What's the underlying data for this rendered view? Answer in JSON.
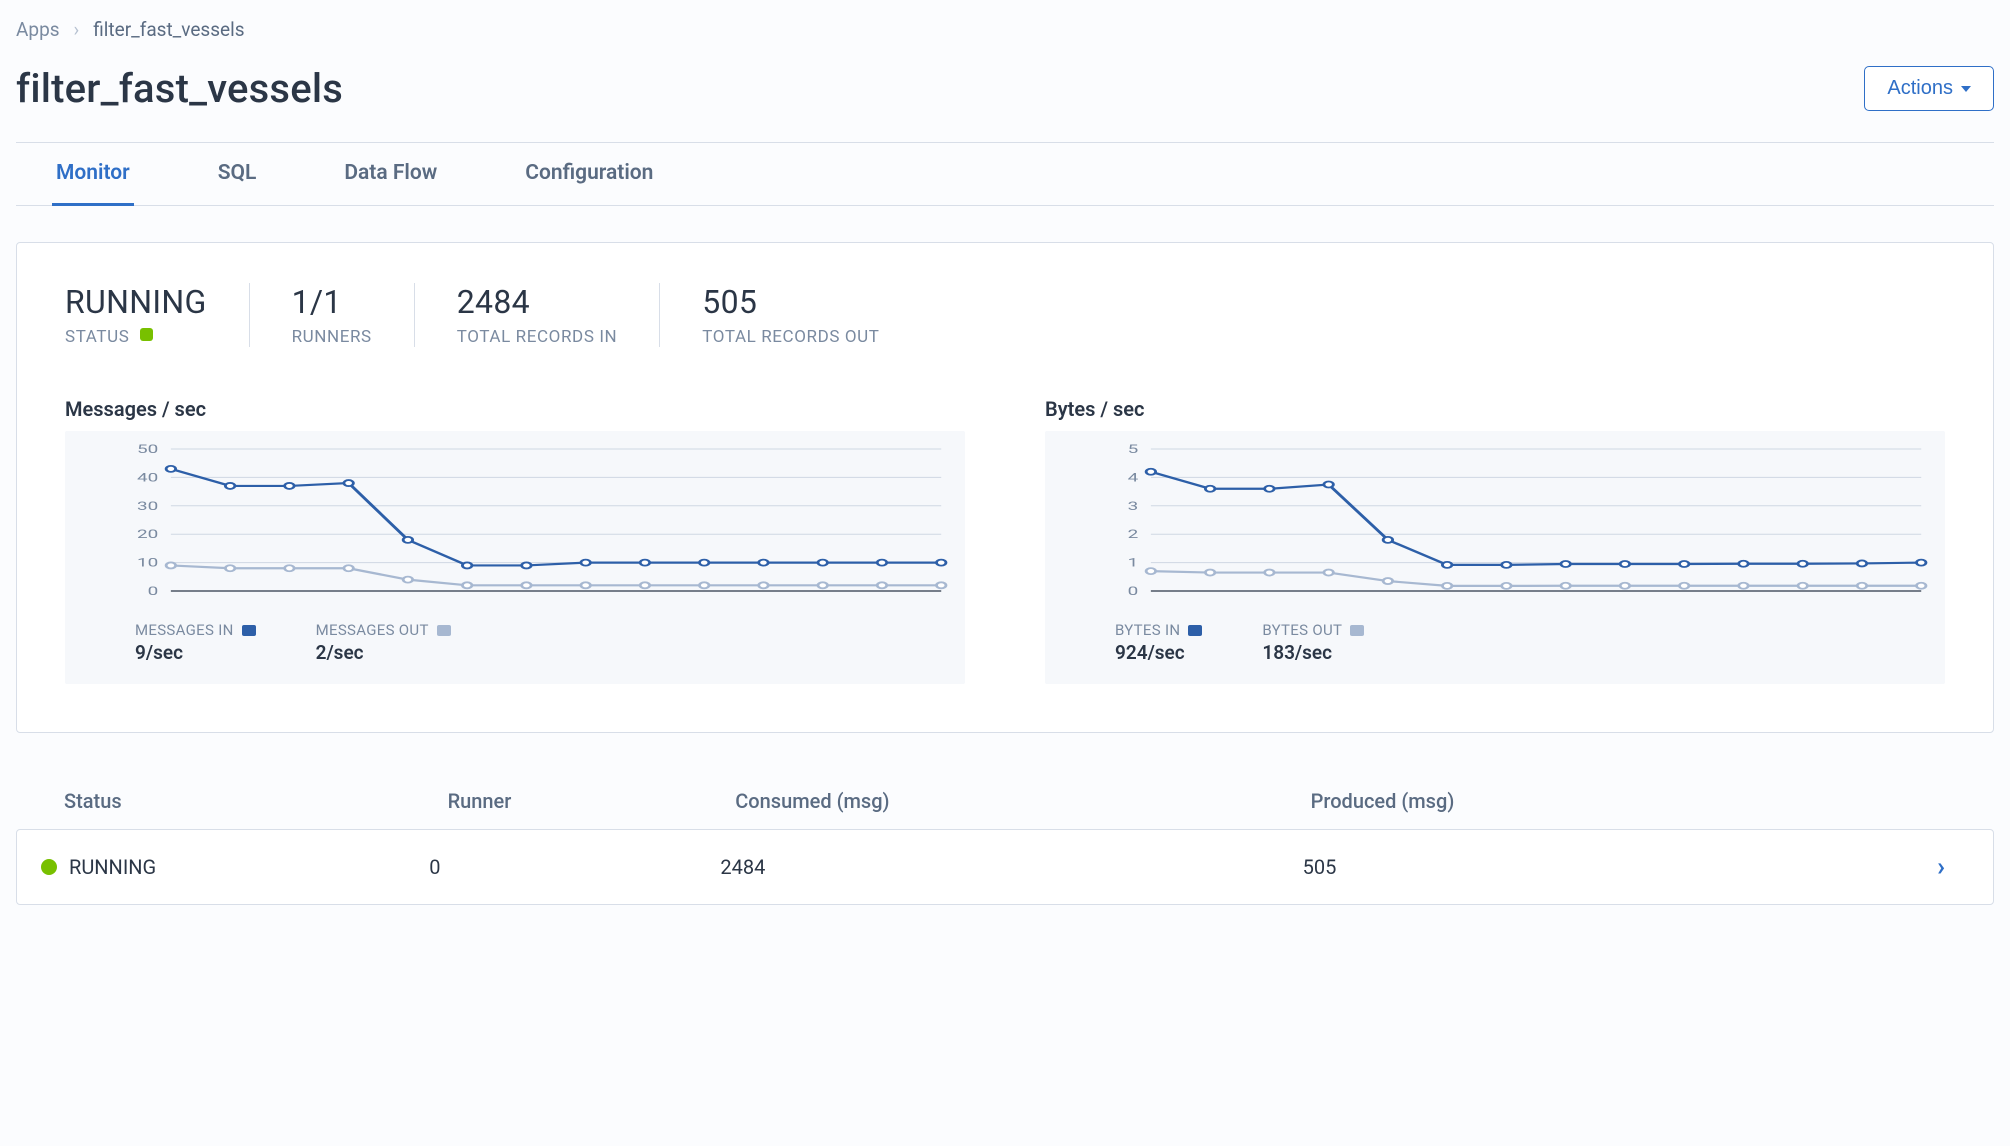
{
  "breadcrumb": {
    "root": "Apps",
    "current": "filter_fast_vessels"
  },
  "page_title": "filter_fast_vessels",
  "actions_label": "Actions",
  "tabs": [
    {
      "label": "Monitor",
      "active": true
    },
    {
      "label": "SQL",
      "active": false
    },
    {
      "label": "Data Flow",
      "active": false
    },
    {
      "label": "Configuration",
      "active": false
    }
  ],
  "stats": {
    "status": {
      "value": "RUNNING",
      "label": "STATUS"
    },
    "runners": {
      "value": "1/1",
      "label": "RUNNERS"
    },
    "records_in": {
      "value": "2484",
      "label": "TOTAL RECORDS IN"
    },
    "records_out": {
      "value": "505",
      "label": "TOTAL RECORDS OUT"
    }
  },
  "charts": {
    "messages": {
      "title": "Messages / sec",
      "legend_in": "MESSAGES IN",
      "legend_out": "MESSAGES OUT",
      "rate_in": "9/sec",
      "rate_out": "2/sec"
    },
    "bytes": {
      "title": "Bytes / sec",
      "legend_in": "BYTES IN",
      "legend_out": "BYTES OUT",
      "rate_in": "924/sec",
      "rate_out": "183/sec"
    }
  },
  "table": {
    "headers": {
      "status": "Status",
      "runner": "Runner",
      "consumed": "Consumed (msg)",
      "produced": "Produced (msg)"
    },
    "row": {
      "status": "RUNNING",
      "runner": "0",
      "consumed": "2484",
      "produced": "505"
    }
  },
  "chart_data": [
    {
      "type": "line",
      "title": "Messages / sec",
      "ylim": [
        0,
        50
      ],
      "yticks": [
        0,
        10,
        20,
        30,
        40,
        50
      ],
      "x": [
        0,
        1,
        2,
        3,
        4,
        5,
        6,
        7,
        8,
        9,
        10,
        11,
        12,
        13
      ],
      "series": [
        {
          "name": "MESSAGES IN",
          "color": "#2d5fa8",
          "values": [
            43,
            37,
            37,
            38,
            18,
            9,
            9,
            10,
            10,
            10,
            10,
            10,
            10,
            10
          ]
        },
        {
          "name": "MESSAGES OUT",
          "color": "#a7b8d1",
          "values": [
            9,
            8,
            8,
            8,
            4,
            2,
            2,
            2,
            2,
            2,
            2,
            2,
            2,
            2
          ]
        }
      ]
    },
    {
      "type": "line",
      "title": "Bytes / sec",
      "ylim": [
        0,
        5000
      ],
      "yticks": [
        0,
        1000,
        2000,
        3000,
        4000,
        5000
      ],
      "x": [
        0,
        1,
        2,
        3,
        4,
        5,
        6,
        7,
        8,
        9,
        10,
        11,
        12,
        13
      ],
      "series": [
        {
          "name": "BYTES IN",
          "color": "#2d5fa8",
          "values": [
            4200,
            3600,
            3600,
            3750,
            1800,
            920,
            920,
            950,
            950,
            950,
            960,
            960,
            970,
            1000
          ]
        },
        {
          "name": "BYTES OUT",
          "color": "#a7b8d1",
          "values": [
            700,
            650,
            650,
            650,
            350,
            180,
            180,
            185,
            185,
            185,
            185,
            185,
            185,
            185
          ]
        }
      ]
    }
  ]
}
